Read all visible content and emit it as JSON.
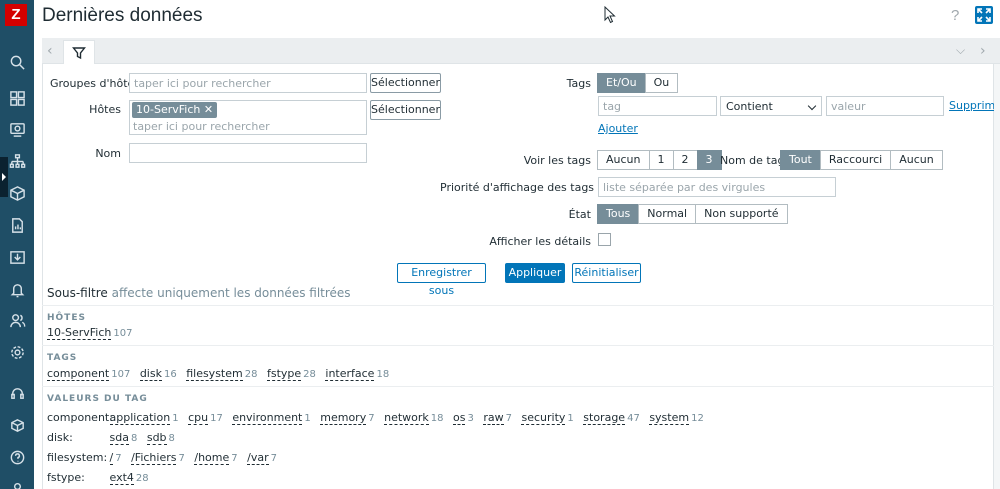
{
  "app": {
    "logo_letter": "Z"
  },
  "header": {
    "title": "Dernières données",
    "help": "?"
  },
  "filter": {
    "host_groups": {
      "label": "Groupes d'hôtes",
      "placeholder": "taper ici pour rechercher",
      "select_label": "Sélectionner"
    },
    "hosts": {
      "label": "Hôtes",
      "chip": "10-ServFich",
      "placeholder": "taper ici pour rechercher",
      "select_label": "Sélectionner"
    },
    "name": {
      "label": "Nom",
      "value": ""
    },
    "tags": {
      "label": "Tags",
      "operators": [
        "Et/Ou",
        "Ou"
      ],
      "active_operator": "Et/Ou",
      "tag_placeholder": "tag",
      "condition": "Contient",
      "value_placeholder": "valeur",
      "remove_label": "Supprimer",
      "add_label": "Ajouter"
    },
    "show_tags": {
      "label": "Voir les tags",
      "options": [
        "Aucun",
        "1",
        "2",
        "3"
      ],
      "active": "3"
    },
    "tag_name": {
      "label": "Nom de tag",
      "options": [
        "Tout",
        "Raccourci",
        "Aucun"
      ],
      "active": "Tout"
    },
    "tag_priority": {
      "label": "Priorité d'affichage des tags",
      "placeholder": "liste séparée par des virgules"
    },
    "state": {
      "label": "État",
      "options": [
        "Tous",
        "Normal",
        "Non supporté"
      ],
      "active": "Tous"
    },
    "details": {
      "label": "Afficher les détails"
    }
  },
  "actions": {
    "save_as": "Enregistrer sous",
    "apply": "Appliquer",
    "reset": "Réinitialiser"
  },
  "subfilter": {
    "title": "Sous-filtre",
    "note": "affecte uniquement les données filtrées",
    "hosts_head": "HÔTES",
    "hosts": [
      {
        "name": "10-ServFich",
        "count": "107"
      }
    ],
    "tags_head": "TAGS",
    "tags": [
      {
        "name": "component",
        "count": "107"
      },
      {
        "name": "disk",
        "count": "16"
      },
      {
        "name": "filesystem",
        "count": "28"
      },
      {
        "name": "fstype",
        "count": "28"
      },
      {
        "name": "interface",
        "count": "18"
      }
    ],
    "values_head": "VALEURS DU TAG",
    "values": [
      {
        "label": "component:",
        "items": [
          {
            "name": "application",
            "count": "1"
          },
          {
            "name": "cpu",
            "count": "17"
          },
          {
            "name": "environment",
            "count": "1"
          },
          {
            "name": "memory",
            "count": "7"
          },
          {
            "name": "network",
            "count": "18"
          },
          {
            "name": "os",
            "count": "3"
          },
          {
            "name": "raw",
            "count": "7"
          },
          {
            "name": "security",
            "count": "1"
          },
          {
            "name": "storage",
            "count": "47"
          },
          {
            "name": "system",
            "count": "12"
          }
        ]
      },
      {
        "label": "disk:",
        "items": [
          {
            "name": "sda",
            "count": "8"
          },
          {
            "name": "sdb",
            "count": "8"
          }
        ]
      },
      {
        "label": "filesystem:",
        "items": [
          {
            "name": "/",
            "count": "7"
          },
          {
            "name": "/Fichiers",
            "count": "7"
          },
          {
            "name": "/home",
            "count": "7"
          },
          {
            "name": "/var",
            "count": "7"
          }
        ]
      },
      {
        "label": "fstype:",
        "items": [
          {
            "name": "ext4",
            "count": "28"
          }
        ]
      }
    ]
  },
  "icons": {
    "sidebar": [
      "search-icon",
      "dashboard-icon",
      "monitoring-icon",
      "hierarchy-icon",
      "inventory-icon",
      "reports-icon",
      "data-collection-icon",
      "alerts-icon",
      "users-icon",
      "settings-icon",
      "support-icon",
      "integrations-icon",
      "help-icon",
      "user-icon"
    ]
  },
  "colors": {
    "sidebar": "#1f4e66",
    "accent": "#0275b8",
    "logo": "#d40000",
    "segment_active": "#768d99"
  }
}
